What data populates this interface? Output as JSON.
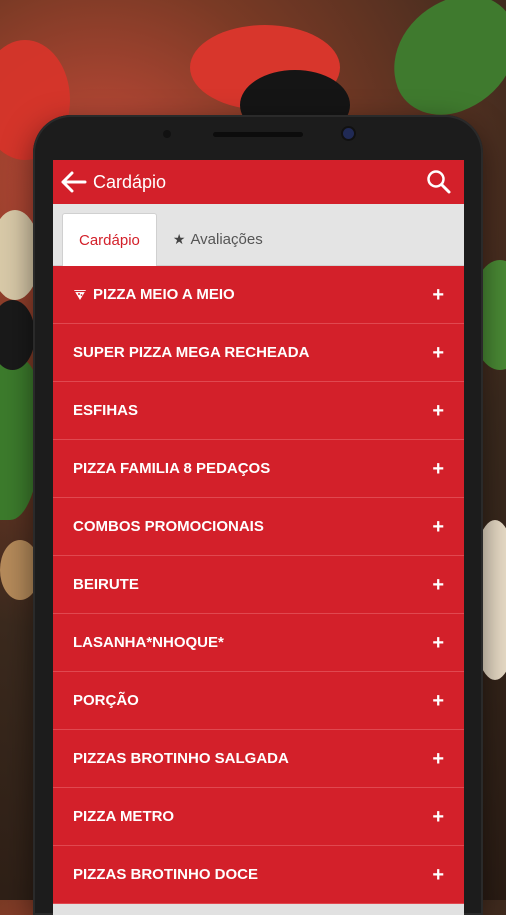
{
  "appbar": {
    "title": "Cardápio",
    "back_icon": "arrow-left-icon",
    "search_icon": "search-icon",
    "color": "#d3202a"
  },
  "tabs": [
    {
      "label": "Cardápio",
      "active": true
    },
    {
      "label": "Avaliações",
      "active": false,
      "icon": "star-icon"
    }
  ],
  "menu": [
    {
      "label": "PIZZA MEIO A MEIO",
      "icon": "pizza-slice-icon",
      "action": "+"
    },
    {
      "label": "SUPER PIZZA MEGA RECHEADA",
      "action": "+"
    },
    {
      "label": "ESFIHAS",
      "action": "+"
    },
    {
      "label": "PIZZA FAMILIA 8 PEDAÇOS",
      "action": "+"
    },
    {
      "label": "COMBOS PROMOCIONAIS",
      "action": "+"
    },
    {
      "label": "BEIRUTE",
      "action": "+"
    },
    {
      "label": "LASANHA*NHOQUE*",
      "action": "+"
    },
    {
      "label": "PORÇÃO",
      "action": "+"
    },
    {
      "label": "PIZZAS BROTINHO SALGADA",
      "action": "+"
    },
    {
      "label": "PIZZA METRO",
      "action": "+"
    },
    {
      "label": "PIZZAS BROTINHO DOCE",
      "action": "+"
    }
  ]
}
